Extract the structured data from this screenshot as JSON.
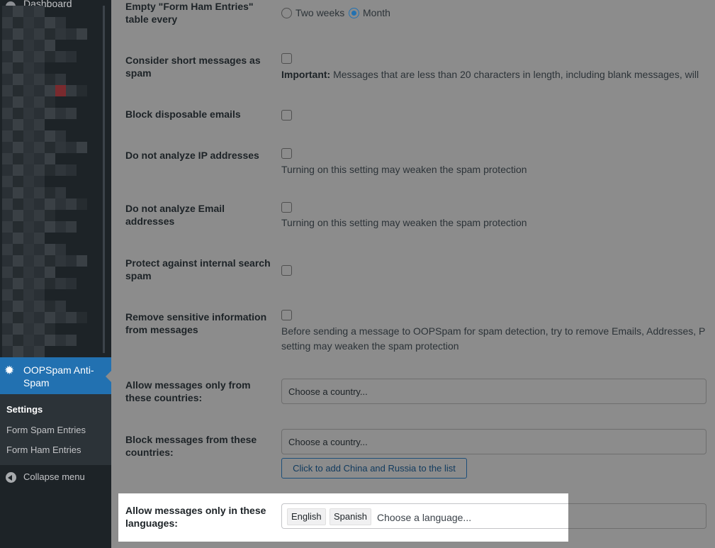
{
  "sidebar": {
    "dashboard_label": "Dashboard",
    "plugin": {
      "label": "OOPSpam Anti-Spam",
      "icon": "oopspam-logo-icon"
    },
    "submenu": [
      {
        "label": "Settings",
        "current": true
      },
      {
        "label": "Form Spam Entries",
        "current": false
      },
      {
        "label": "Form Ham Entries",
        "current": false
      }
    ],
    "collapse_label": "Collapse menu",
    "accent_color": "#2271b1"
  },
  "settings": {
    "empty_ham": {
      "label": "Empty \"Form Ham Entries\" table every",
      "options": [
        "Two weeks",
        "Month"
      ],
      "selected": "Month"
    },
    "short_messages": {
      "label": "Consider short messages as spam",
      "checked": false,
      "note_strong": "Important:",
      "note": " Messages that are less than 20 characters in length, including blank messages, will"
    },
    "disposable_emails": {
      "label": "Block disposable emails",
      "checked": false
    },
    "no_ip": {
      "label": "Do not analyze IP addresses",
      "checked": false,
      "note": "Turning on this setting may weaken the spam protection"
    },
    "no_email": {
      "label": "Do not analyze Email addresses",
      "checked": false,
      "note": "Turning on this setting may weaken the spam protection"
    },
    "internal_search": {
      "label": "Protect against internal search spam",
      "checked": false
    },
    "remove_sensitive": {
      "label": "Remove sensitive information from messages",
      "checked": false,
      "note_line1": "Before sending a message to OOPSpam for spam detection, try to remove Emails, Addresses, P",
      "note_line2": "setting may weaken the spam protection"
    },
    "allow_countries": {
      "label": "Allow messages only from these countries:",
      "placeholder": "Choose a country..."
    },
    "block_countries": {
      "label": "Block messages from these countries:",
      "placeholder": "Choose a country...",
      "button": "Click to add China and Russia to the list"
    },
    "allow_languages": {
      "label": "Allow messages only in these languages:",
      "tags": [
        "English",
        "Spanish"
      ],
      "placeholder": "Choose a language..."
    }
  }
}
